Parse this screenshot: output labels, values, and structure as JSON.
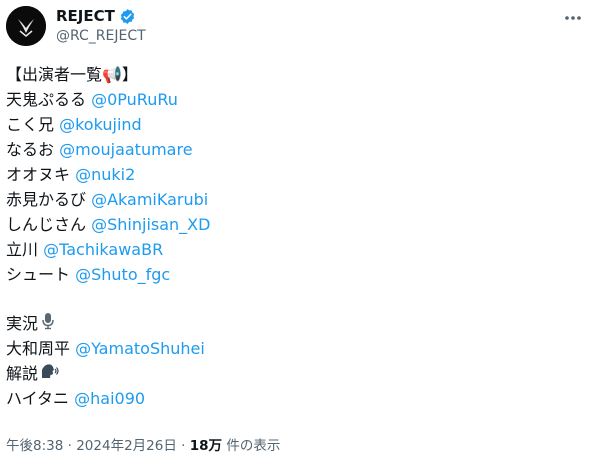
{
  "tweet": {
    "display_name": "REJECT",
    "handle": "@RC_REJECT",
    "header_line": "【出演者一覧📢】",
    "cast": [
      {
        "name": "天鬼ぷるる",
        "mention": "@0PuRuRu"
      },
      {
        "name": "こく兄",
        "mention": "@kokujind"
      },
      {
        "name": "なるお",
        "mention": "@moujaatumare"
      },
      {
        "name": "オオヌキ",
        "mention": "@nuki2"
      },
      {
        "name": "赤見かるび",
        "mention": "@AkamiKarubi"
      },
      {
        "name": "しんじさん",
        "mention": "@Shinjisan_XD"
      },
      {
        "name": "立川",
        "mention": "@TachikawaBR"
      },
      {
        "name": "シュート",
        "mention": "@Shuto_fgc"
      }
    ],
    "commentary_label": "実況",
    "commentary_icon": "microphone-icon",
    "commentator": {
      "name": "大和周平",
      "mention": "@YamatoShuhei"
    },
    "analysis_label": "解説",
    "analysis_icon": "speaking-head-icon",
    "analyst": {
      "name": "ハイタニ",
      "mention": "@hai090"
    },
    "time": "午後8:38",
    "separator": "·",
    "date": "2024年2月26日",
    "views_count": "18万",
    "views_label": "件の表示"
  },
  "colors": {
    "link": "#1d9bf0",
    "text": "#0f1419",
    "muted": "#536471",
    "verified": "#1d9bf0"
  }
}
